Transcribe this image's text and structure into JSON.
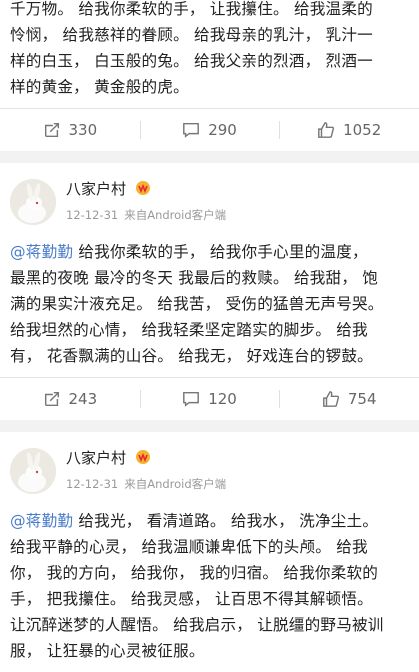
{
  "posts": [
    {
      "lines": [
        "千万物。  给我你柔软的手，  让我攥住。  给我温柔的",
        "怜悯，  给我慈祥的眷顾。  给我母亲的乳汁，  乳汁一",
        "样的白玉，  白玉般的兔。  给我父亲的烈酒，  烈酒一",
        "样的黄金，  黄金般的虎。"
      ],
      "repost_count": "330",
      "comment_count": "290",
      "like_count": "1052"
    },
    {
      "username": "八家户村",
      "date": "12-12-31",
      "source": "来自Android客户端",
      "mention": "@蒋勤勤",
      "lines": [
        "给我你柔软的手，  给我你手心里的温度，",
        "最黑的夜晚 最冷的冬天 我最后的救赎。  给我甜，  饱",
        "满的果实汁液充足。  给我苦，  受伤的猛兽无声号哭。",
        "给我坦然的心情，  给我轻柔坚定踏实的脚步。  给我",
        "有，  花香飘满的山谷。  给我无，  好戏连台的锣鼓。"
      ],
      "repost_count": "243",
      "comment_count": "120",
      "like_count": "754"
    },
    {
      "username": "八家户村",
      "date": "12-12-31",
      "source": "来自Android客户端",
      "mention": "@蒋勤勤",
      "lines": [
        "给我光，  看清道路。  给我水，  洗净尘土。",
        "给我平静的心灵，  给我温顺谦卑低下的头颅。  给我",
        "你，  我的方向，  给我你，  我的归宿。  给我你柔软的",
        "手，  把我攥住。  给我灵感，  让百思不得其解顿悟。",
        "让沉醉迷梦的人醒悟。  给我启示，  让脱缰的野马被训",
        "服，  让狂暴的心灵被征服。"
      ]
    }
  ],
  "colors": {
    "mention": "#4a7cc9",
    "meta": "#9a9a9a",
    "action_text": "#666666"
  },
  "icons": [
    "repost-icon",
    "comment-icon",
    "like-icon",
    "vip-badge-icon",
    "rabbit-avatar"
  ]
}
